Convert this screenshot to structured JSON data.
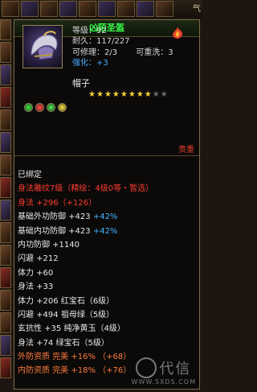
{
  "top_bar": {
    "label": "气"
  },
  "left_tags": [
    {
      "text": "i",
      "offset": 67
    },
    {
      "text": "",
      "offset": 0
    }
  ],
  "item": {
    "title": "凶陌圣盔",
    "level": "等级：92",
    "durability": "耐久：117/227",
    "repairable": "可修理：2/3",
    "rewash": "可重洗：3",
    "enhance_label": "强化：",
    "enhance_value": "+3",
    "name": "帽子",
    "stars_filled": 8,
    "stars_total": 10,
    "valuable": "贵重"
  },
  "stat_lines": [
    {
      "text": "已绑定",
      "color": "white"
    },
    {
      "text": "身法雕纹7级（精绘：4级0等・暂选）",
      "color": "red"
    },
    {
      "text": "身法 +296（+126）",
      "color": "red"
    },
    {
      "text": "基础外功防御  +423  +42%",
      "color": "white",
      "extra": ""
    },
    {
      "text": "基础内功防御  +423  +42%",
      "color": "white"
    },
    {
      "text": "内功防御  +1140",
      "color": "white"
    },
    {
      "text": "闪避  +212",
      "color": "white"
    },
    {
      "text": "体力  +60",
      "color": "white"
    },
    {
      "text": "身法  +33",
      "color": "white"
    },
    {
      "text": "体力  +206  红宝石（6级）",
      "color": "white"
    },
    {
      "text": "闪避  +494  祖母绿（5级）",
      "color": "white"
    },
    {
      "text": "玄抗性  +35  纯净黄玉（4级）",
      "color": "white"
    },
    {
      "text": "身法  +74  绿宝石（5级）",
      "color": "white"
    },
    {
      "text": "外防资质   完美  +16%  （+68）",
      "color": "orange"
    },
    {
      "text": "内防资质   完美  +18%  （+76）",
      "color": "orange"
    }
  ],
  "watermark": {
    "text": "代信",
    "url": "WWW.SXDS.COM"
  },
  "colors": {
    "title_green": "#35ff4a",
    "stat_blue": "#42b4ff",
    "stat_red": "#ff3b30",
    "stat_orange": "#ff7a3c"
  }
}
